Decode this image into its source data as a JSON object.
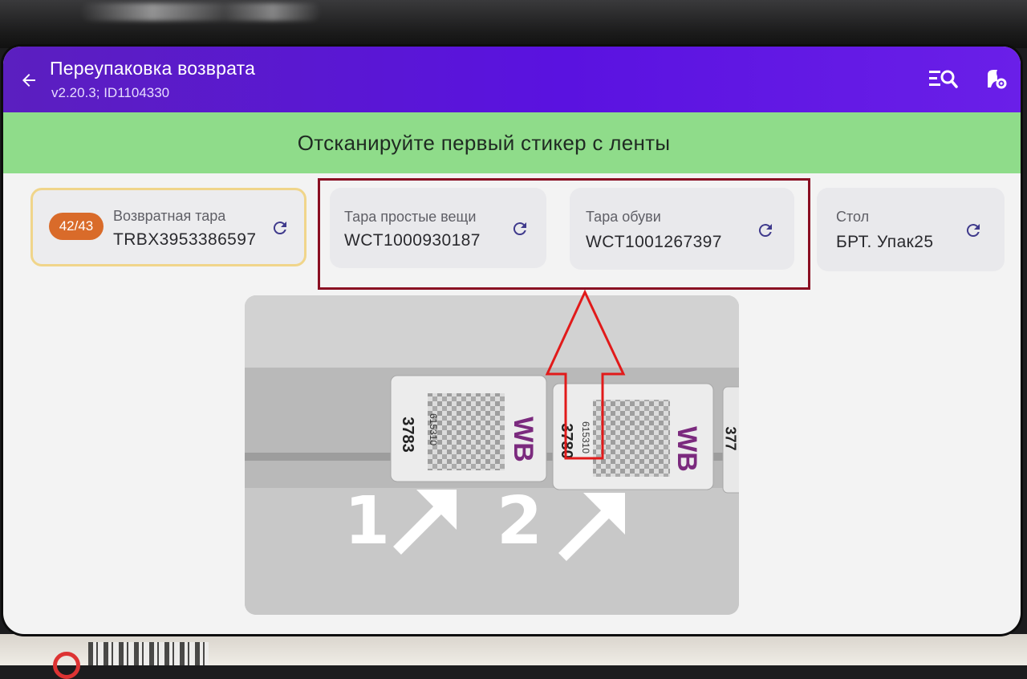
{
  "header": {
    "title": "Переупаковка возврата",
    "subtitle": "v2.20.3; ID1104330"
  },
  "banner": {
    "text": "Отсканируйте первый стикер с ленты"
  },
  "cards": [
    {
      "badge": "42/43",
      "label": "Возвратная тара",
      "value": "TRBX3953386597"
    },
    {
      "label": "Тара простые вещи",
      "value": "WCT1000930187"
    },
    {
      "label": "Тара обуви",
      "value": "WCT1001267397"
    },
    {
      "label": "Стол",
      "value": "БРТ. Упак25"
    }
  ],
  "photo": {
    "sticker1": {
      "code": "615310",
      "num": "3783",
      "brand": "WB"
    },
    "sticker2": {
      "code": "615310",
      "num": "3780",
      "brand": "WB"
    },
    "sticker3_partial": "377",
    "step1": "1",
    "step2": "2"
  },
  "colors": {
    "appbar": "#5a12e0",
    "banner": "#8fdc8a",
    "badge": "#d96b2a",
    "highlight_frame": "#8a0f22",
    "annotation_arrow": "#e11a1a",
    "brand_wb": "#7b2a7e"
  }
}
